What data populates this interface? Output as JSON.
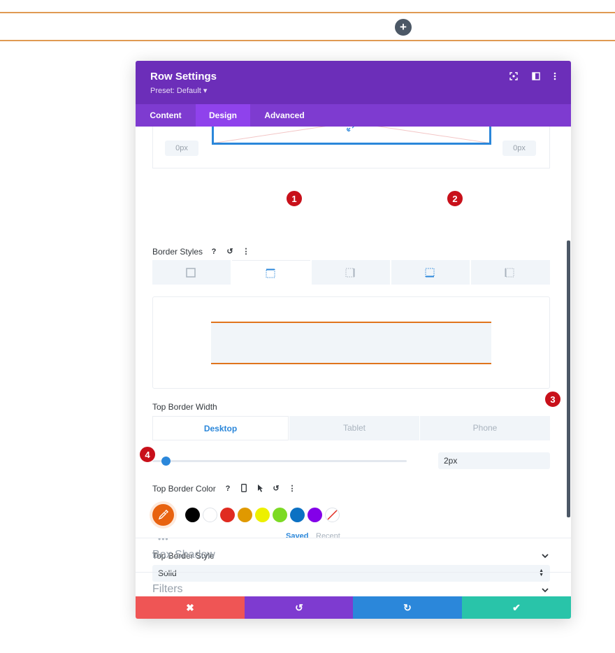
{
  "page": {
    "add_section_icon": "plus-icon"
  },
  "modal": {
    "title": "Row Settings",
    "preset": "Preset: Default ▾",
    "header_icons": [
      "fullscreen-icon",
      "sidebar-icon",
      "more-icon"
    ],
    "tabs": [
      {
        "label": "Content",
        "active": false
      },
      {
        "label": "Design",
        "active": true
      },
      {
        "label": "Advanced",
        "active": false
      }
    ],
    "spacing_preview": {
      "left_value": "0px",
      "right_value": "0px",
      "link_icon": "link-icon"
    },
    "border_styles": {
      "label": "Border Styles",
      "tabs": [
        "all-borders-icon",
        "top-border-icon",
        "right-border-icon",
        "bottom-border-icon",
        "left-border-icon"
      ],
      "active_tab": 1
    },
    "top_border_width": {
      "label": "Top Border Width",
      "devices": [
        "Desktop",
        "Tablet",
        "Phone"
      ],
      "active_device": "Desktop",
      "value": "2px",
      "slider_fraction": 0.04
    },
    "top_border_color": {
      "label": "Top Border Color",
      "current_color": "#e8620f",
      "swatches": [
        "#000000",
        "#ffffff",
        "#e02b20",
        "#e09900",
        "#edf000",
        "#7cda24",
        "#0c71c3",
        "#8300e9"
      ],
      "saved_label": "Saved",
      "recent_label": "Recent"
    },
    "top_border_style": {
      "label": "Top Border Style",
      "value": "Solid"
    },
    "groups": [
      {
        "title": "Box Shadow"
      },
      {
        "title": "Filters"
      }
    ],
    "footer": {
      "cancel_color": "#ef5555",
      "undo_color": "#7e3bd0",
      "redo_color": "#2b87da",
      "save_color": "#29c4a9"
    }
  },
  "annotations": [
    "1",
    "2",
    "3",
    "4"
  ],
  "colors": {
    "purple_header": "#6c2eb9",
    "tab_bar": "#7e3bd0",
    "accent_blue": "#2b87da",
    "border_orange": "#e0741d"
  }
}
